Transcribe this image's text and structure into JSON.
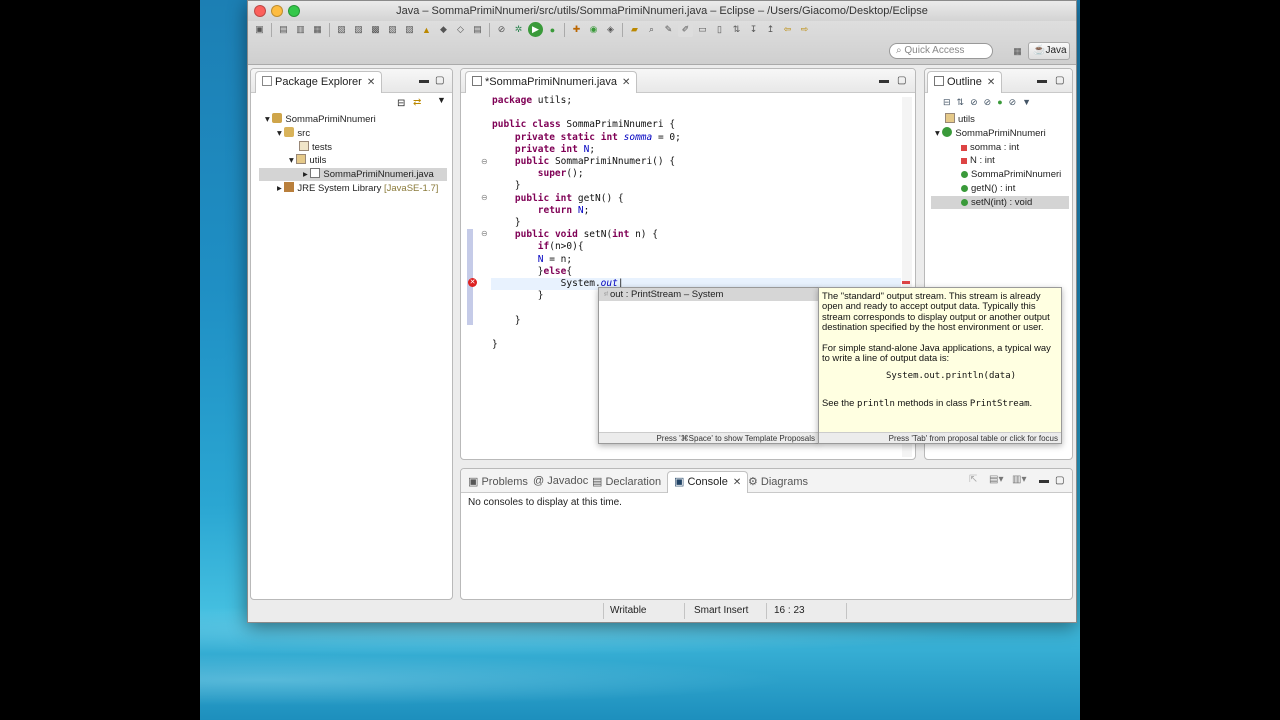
{
  "window": {
    "title": "Java – SommaPrimiNnumeri/src/utils/SommaPrimiNnumeri.java – Eclipse – /Users/Giacomo/Desktop/Eclipse"
  },
  "toolbar": {
    "quick_access_placeholder": "Quick Access",
    "perspective_label": "Java"
  },
  "package_explorer": {
    "title": "Package Explorer",
    "tree": {
      "project": "SommaPrimiNnumeri",
      "src": "src",
      "tests": "tests",
      "utils": "utils",
      "file": "SommaPrimiNnumeri.java",
      "jre": "JRE System Library",
      "jre_version": "[JavaSE-1.7]"
    }
  },
  "editor": {
    "tab_label": "*SommaPrimiNnumeri.java",
    "lines": [
      "package utils;",
      "",
      "public class SommaPrimiNnumeri {",
      "    private static int somma = 0;",
      "    private int N;",
      "    public SommaPrimiNnumeri() {",
      "        super();",
      "    }",
      "    public int getN() {",
      "        return N;",
      "    }",
      "    public void setN(int n) {",
      "        if(n>0){",
      "        N = n;",
      "        }else{",
      "            System.out",
      "        }",
      "",
      "    }",
      "",
      "}"
    ]
  },
  "content_assist": {
    "proposal": "out : PrintStream – System",
    "footer": "Press '⌘Space' to show Template Proposals",
    "doc_p1": "The \"standard\" output stream. This stream is already open and ready to accept output data. Typically this stream corresponds to display output or another output destination specified by the host environment or user.",
    "doc_p2": "For simple stand-alone Java applications, a typical way to write a line of output data is:",
    "doc_code": "System.out.println(data)",
    "doc_p3_pre": "See the ",
    "doc_p3_code1": "println",
    "doc_p3_mid": " methods in class ",
    "doc_p3_code2": "PrintStream",
    "doc_p3_post": ".",
    "doc_footer": "Press 'Tab' from proposal table or click for focus"
  },
  "outline": {
    "title": "Outline",
    "items": [
      "utils",
      "SommaPrimiNnumeri",
      "somma : int",
      "N : int",
      "SommaPrimiNnumeri",
      "getN() : int",
      "setN(int) : void"
    ]
  },
  "bottom": {
    "tabs": [
      "Problems",
      "Javadoc",
      "Declaration",
      "Console",
      "Diagrams"
    ],
    "console_message": "No consoles to display at this time."
  },
  "status": {
    "writable": "Writable",
    "insert_mode": "Smart Insert",
    "position": "16 : 23"
  }
}
